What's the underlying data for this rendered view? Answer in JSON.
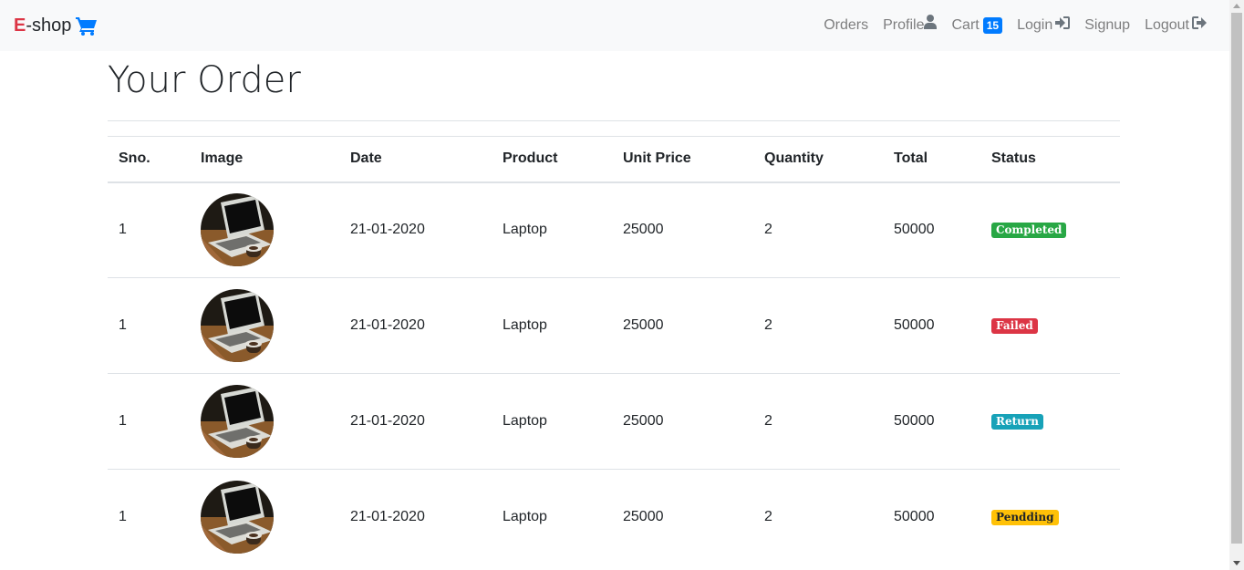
{
  "brand": {
    "letter": "E",
    "rest": "-shop",
    "icon": "shopping-cart-icon",
    "icon_color": "#007bff",
    "letter_color": "#dc3545"
  },
  "nav": {
    "orders": "Orders",
    "profile": "Profile",
    "cart": "Cart",
    "cart_count": "15",
    "login": "Login",
    "signup": "Signup",
    "logout": "Logout"
  },
  "page": {
    "title": "Your Order"
  },
  "table": {
    "headers": {
      "sno": "Sno.",
      "image": "Image",
      "date": "Date",
      "product": "Product",
      "unit_price": "Unit Price",
      "quantity": "Quantity",
      "total": "Total",
      "status": "Status"
    },
    "rows": [
      {
        "sno": "1",
        "date": "21-01-2020",
        "product": "Laptop",
        "unit_price": "25000",
        "quantity": "2",
        "total": "50000",
        "status": "Completed",
        "status_color": "#28a745",
        "status_text_color": "#ffffff"
      },
      {
        "sno": "1",
        "date": "21-01-2020",
        "product": "Laptop",
        "unit_price": "25000",
        "quantity": "2",
        "total": "50000",
        "status": "Failed",
        "status_color": "#dc3545",
        "status_text_color": "#ffffff"
      },
      {
        "sno": "1",
        "date": "21-01-2020",
        "product": "Laptop",
        "unit_price": "25000",
        "quantity": "2",
        "total": "50000",
        "status": "Return",
        "status_color": "#17a2b8",
        "status_text_color": "#ffffff"
      },
      {
        "sno": "1",
        "date": "21-01-2020",
        "product": "Laptop",
        "unit_price": "25000",
        "quantity": "2",
        "total": "50000",
        "status": "Pendding",
        "status_color": "#ffc107",
        "status_text_color": "#212529"
      }
    ]
  }
}
